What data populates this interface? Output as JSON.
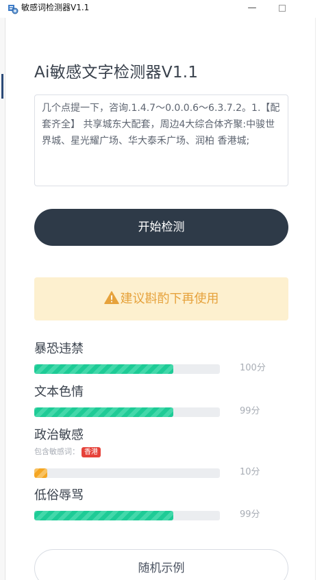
{
  "window": {
    "title": "敏感词检测器V1.1",
    "minimize_glyph": "—",
    "icon": "app-gear-icon"
  },
  "main": {
    "heading": "Ai敏感文字检测器V1.1",
    "input_text": "几个点提一下，咨询.1.4.7～0.0.0.6～6.3.7.2。1.【配套齐全】 共享城东大配套，周边4大综合体齐聚:中骏世界城、星光耀广场、华大泰禾广场、润柏 香港城;",
    "detect_button": "开始检测",
    "warning": {
      "icon": "warning-triangle-icon",
      "text": "建议斟酌下再使用",
      "color": "#e6a23c"
    },
    "categories": [
      {
        "label": "暴恐违禁",
        "score_text": "100分",
        "level": 0.75
      },
      {
        "label": "文本色情",
        "score_text": "99分",
        "level": 0.75
      },
      {
        "label": "政治敏感",
        "score_text": "10分",
        "level": 0.07,
        "hint_label": "包含敏感词：",
        "hint_tag": "香港"
      },
      {
        "label": "低俗辱骂",
        "score_text": "99分",
        "level": 0.75
      }
    ],
    "random_button": "随机示例"
  },
  "colors": {
    "bar_fill": "#1ecb96",
    "bar_fill_low": "#f5a623",
    "primary_button": "#2e3a48",
    "tag": "#e6423a"
  }
}
